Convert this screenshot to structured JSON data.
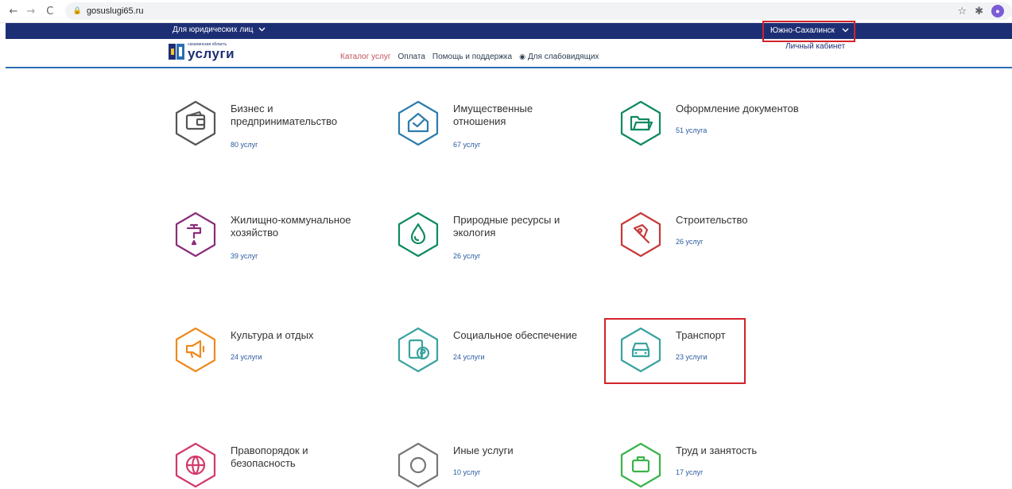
{
  "browser": {
    "url": "gosuslugi65.ru",
    "nav": {
      "back": "←",
      "forward": "→",
      "reload": "C"
    },
    "icons": [
      "star-icon",
      "extensions-icon",
      "profile-icon"
    ]
  },
  "topbar": {
    "legal_entities": "Для юридических лиц",
    "region": "Южно-Сахалинск"
  },
  "header": {
    "logo_small": "сахалинская область",
    "logo_big": "услуги",
    "menu": [
      "Каталог услуг",
      "Оплата",
      "Помощь и поддержка",
      "Для слабовидящих"
    ],
    "active_menu": "Каталог услуг",
    "cabinet": "Личный кабинет"
  },
  "colors": {
    "brand_dark": "#1d2f74",
    "accent_line": "#2a6db5",
    "highlight_red": "#d2232a",
    "active_link": "#c0505a"
  },
  "categories": [
    {
      "title": "Бизнес и предпринимательство",
      "line1": "Бизнес и",
      "line2": "предпринимательство",
      "count": "80 услуг",
      "icon": "wallet-icon",
      "color": "#555555"
    },
    {
      "title": "Имущественные отношения",
      "line1": "Имущественные",
      "line2": "отношения",
      "count": "67 услуг",
      "icon": "house-check-icon",
      "color": "#2b7dab"
    },
    {
      "title": "Оформление документов",
      "line1": "Оформление документов",
      "line2": "",
      "count": "51 услуга",
      "icon": "folder-icon",
      "color": "#0f8a5f"
    },
    {
      "title": "Жилищно-коммунальное хозяйство",
      "line1": "Жилищно-коммунальное",
      "line2": "хозяйство",
      "count": "39 услуг",
      "icon": "faucet-icon",
      "color": "#8a2d7a"
    },
    {
      "title": "Природные ресурсы и экология",
      "line1": "Природные ресурсы и",
      "line2": "экология",
      "count": "26 услуг",
      "icon": "drop-icon",
      "color": "#0d8a5f"
    },
    {
      "title": "Строительство",
      "line1": "Строительство",
      "line2": "",
      "count": "26 услуг",
      "icon": "trowel-icon",
      "color": "#c83a3a"
    },
    {
      "title": "Культура и отдых",
      "line1": "Культура и отдых",
      "line2": "",
      "count": "24 услуги",
      "icon": "megaphone-icon",
      "color": "#ef8a1e"
    },
    {
      "title": "Социальное обеспечение",
      "line1": "Социальное обеспечение",
      "line2": "",
      "count": "24 услуги",
      "icon": "ruble-doc-icon",
      "color": "#3aa3a0"
    },
    {
      "title": "Транспорт",
      "line1": "Транспорт",
      "line2": "",
      "count": "23 услуги",
      "icon": "car-icon",
      "color": "#3aa3a0"
    },
    {
      "title": "Правопорядок и безопасность",
      "line1": "Правопорядок и",
      "line2": "безопасность",
      "count": "",
      "icon": "globe-icon",
      "color": "#d23a6a"
    },
    {
      "title": "Иные услуги",
      "line1": "Иные услуги",
      "line2": "",
      "count": "10 услуг",
      "icon": "other-icon",
      "color": "#777777"
    },
    {
      "title": "Труд и занятость",
      "line1": "Труд и занятость",
      "line2": "",
      "count": "17 услуг",
      "icon": "work-icon",
      "color": "#3ab34a"
    }
  ]
}
